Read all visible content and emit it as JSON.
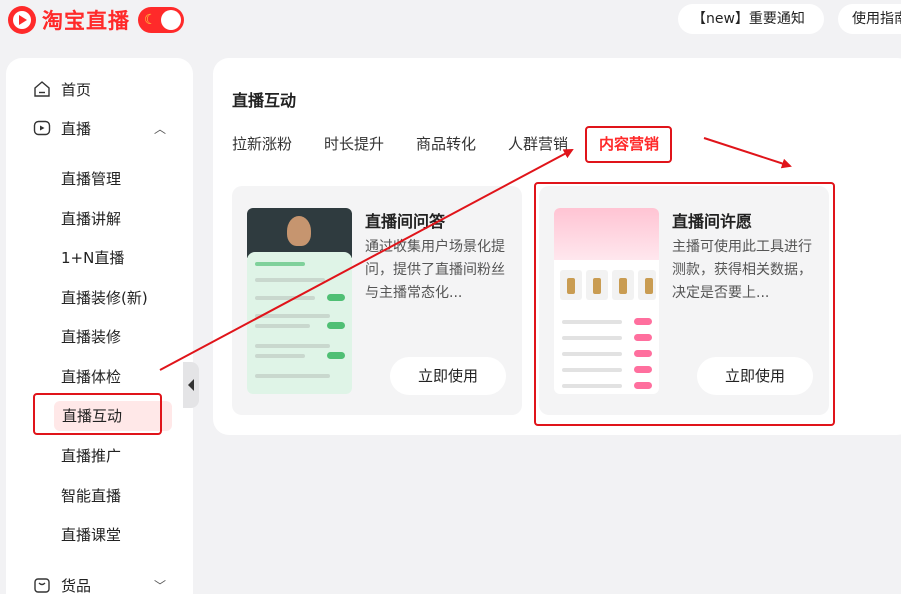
{
  "header": {
    "brand": "淘宝直播",
    "notice_button": "【new】重要通知",
    "guide_button": "使用指南"
  },
  "sidebar": {
    "items": [
      {
        "label": "首页",
        "icon": "home-icon"
      },
      {
        "label": "直播",
        "icon": "live-icon"
      },
      {
        "label": "货品",
        "icon": "bag-icon"
      }
    ],
    "live_subitems": [
      "直播管理",
      "直播讲解",
      "1+N直播",
      "直播装修(新)",
      "直播装修",
      "直播体检",
      "直播互动",
      "直播推广",
      "智能直播",
      "直播课堂"
    ],
    "active_subitem": "直播互动"
  },
  "main": {
    "title": "直播互动",
    "tabs": [
      "拉新涨粉",
      "时长提升",
      "商品转化",
      "人群营销",
      "内容营销"
    ],
    "active_tab": "内容营销",
    "cards": [
      {
        "title": "直播间问答",
        "desc": "通过收集用户场景化提问，提供了直播间粉丝与主播常态化...",
        "button": "立即使用"
      },
      {
        "title": "直播间许愿",
        "desc": "主播可使用此工具进行测款，获得相关数据，决定是否要上...",
        "button": "立即使用"
      }
    ]
  },
  "colors": {
    "brand": "#ff2a2a",
    "annotation": "#e0141a",
    "active_bg": "#ffe8e8"
  }
}
